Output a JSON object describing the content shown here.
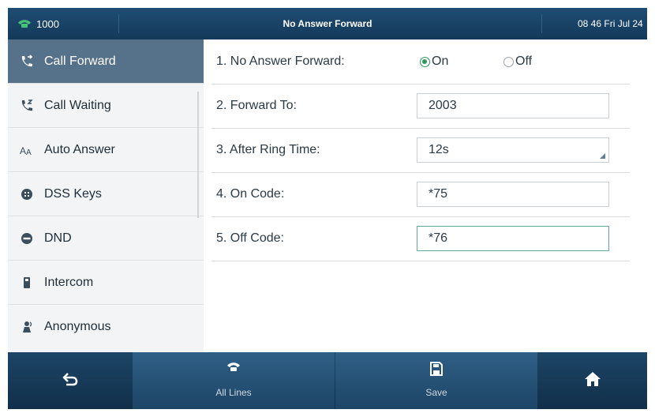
{
  "status_bar": {
    "line": "1000",
    "title": "No Answer Forward",
    "datetime": "08 46 Fri Jul 24"
  },
  "sidebar": {
    "items": [
      {
        "label": "Call Forward",
        "icon": "call-forward-icon",
        "active": true
      },
      {
        "label": "Call Waiting",
        "icon": "call-waiting-icon",
        "active": false
      },
      {
        "label": "Auto Answer",
        "icon": "auto-answer-icon",
        "active": false
      },
      {
        "label": "DSS Keys",
        "icon": "dss-keys-icon",
        "active": false
      },
      {
        "label": "DND",
        "icon": "dnd-icon",
        "active": false
      },
      {
        "label": "Intercom",
        "icon": "intercom-icon",
        "active": false
      },
      {
        "label": "Anonymous",
        "icon": "anonymous-icon",
        "active": false
      }
    ]
  },
  "form": {
    "no_answer_forward": {
      "label": "1. No Answer Forward:",
      "on_label": "On",
      "off_label": "Off",
      "selected": "On"
    },
    "forward_to": {
      "label": "2. Forward To:",
      "value": "2003"
    },
    "after_ring_time": {
      "label": "3. After Ring Time:",
      "value": "12s"
    },
    "on_code": {
      "label": "4. On Code:",
      "value": "*75"
    },
    "off_code": {
      "label": "5. Off Code:",
      "value": "*76"
    }
  },
  "softkeys": {
    "back_icon": "back-arrow-icon",
    "all_lines": "All Lines",
    "save": "Save",
    "home_icon": "home-icon"
  },
  "colors": {
    "status_bar": "#1e4d73",
    "sidebar_active": "#56718a",
    "radio_selected": "#2b9a5a",
    "focused_field_border": "#5da8a0"
  }
}
